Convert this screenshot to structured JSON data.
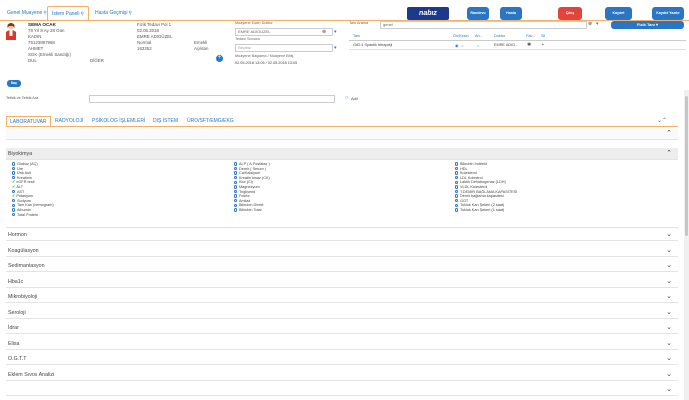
{
  "tabs": [
    {
      "label": "Genel Muayene"
    },
    {
      "label": "İstem Paneli"
    },
    {
      "label": "Hasta Geçmişi"
    }
  ],
  "patient": {
    "name": "SEMA OCAK",
    "age": "76 Yıl 8 Ay 28 Gün",
    "gender": "KADIN",
    "tc": "75123897968",
    "father": "AHMET",
    "insurance": "SGK (Emekli Sandığı)",
    "marital": "DUL",
    "other": "DİĞER",
    "doctor_label": "Fizik Tedavi Pol 1",
    "date": "02.05.2018",
    "doctor": "EMRE ADIGÜZEL",
    "status": "Normal",
    "protocol": "163252",
    "retired": "Emekli",
    "description": "Açıklan"
  },
  "examiner": {
    "label": "Muayene Eden Doktor",
    "value": "EMRE ADIGÜZEL",
    "referral_label": "Tedavi Sonucu",
    "referral_placeholder": "Seçiniz",
    "period_label": "Muayene Başlama / Muayene Bitiş",
    "period": "02.05.2018 13:05 / 02.05.2018 13:05"
  },
  "diagnosis": {
    "search_label": "Tanı Arama",
    "search_value": "genel",
    "chip": "Fizik Tanı",
    "headers": [
      "Tanı",
      "Ön/Kesin",
      "An...",
      "Doktor",
      "Fav...",
      "Sil"
    ],
    "row": {
      "diagnosis": "G82.4 Spastik tetrapleji",
      "doctor": "EMRE ADIG..."
    }
  },
  "logo": {
    "text": "nabız"
  },
  "toolbar": {
    "btn1": "Randevu",
    "btn2": "Hasta",
    "btn3": "Kaydet",
    "btn4": "Kaydet Yazdır",
    "red": "Çıkış"
  },
  "small_btn": "İlaç",
  "search": {
    "label": "Tetkik ve Tetkik Ara",
    "filter": "Adil"
  },
  "test_tabs": [
    {
      "label": "LABORATUVAR"
    },
    {
      "label": "RADYOLOJİ"
    },
    {
      "label": "PSİKOLOG İŞLEMLERİ"
    },
    {
      "label": "DIŞ İSTEM"
    },
    {
      "label": "ÜRO/SFT/EMG/EKG"
    }
  ],
  "biyokimya": {
    "title": "Biyokimya",
    "col1": [
      "Glukoz (AÇ)",
      "Üre",
      "Ürik Asit",
      "Kreatinin",
      "eGFR testi",
      "ALT",
      "AST",
      "Potasyum",
      "Sodyum",
      "Tam Kan (hemogram)",
      "Albumin",
      "Total Protein"
    ],
    "col2": [
      "ALP ( A.Fosfataz )",
      "Demir ( Serum )",
      "Ca/Kalsiyum",
      "Kreatin kinaz (CK)",
      "Klor (Cl)",
      "Magnezyum",
      "Trigliserid",
      "Fosfor",
      "Amilaz",
      "Bilirubin Direkt",
      "Bilirubin Total"
    ],
    "col3": [
      "Bilirubin İndirekt",
      "HDL",
      "Kolesterol",
      "LDL Kolestrol",
      "Laktik Dehidrogenaz (LDH)",
      "VLDL Kolesterol",
      "T.DEMİR BAĞLAMA KAPASİTESİ",
      "Demir bağlama kapasitesi",
      "GGT",
      "Tokluk Kan Şekeri (2 saat)",
      "Tokluk Kan Şekeri (1 saat)"
    ]
  },
  "sections": [
    "Hormon",
    "Koagülasyon",
    "Sedimantasyon",
    "Hba1c",
    "Mikrobiyoloji",
    "Seroloji",
    "İdrar",
    "Elisa",
    "O.G.T.T",
    "Eklem Sıvısı Analizi",
    ""
  ]
}
